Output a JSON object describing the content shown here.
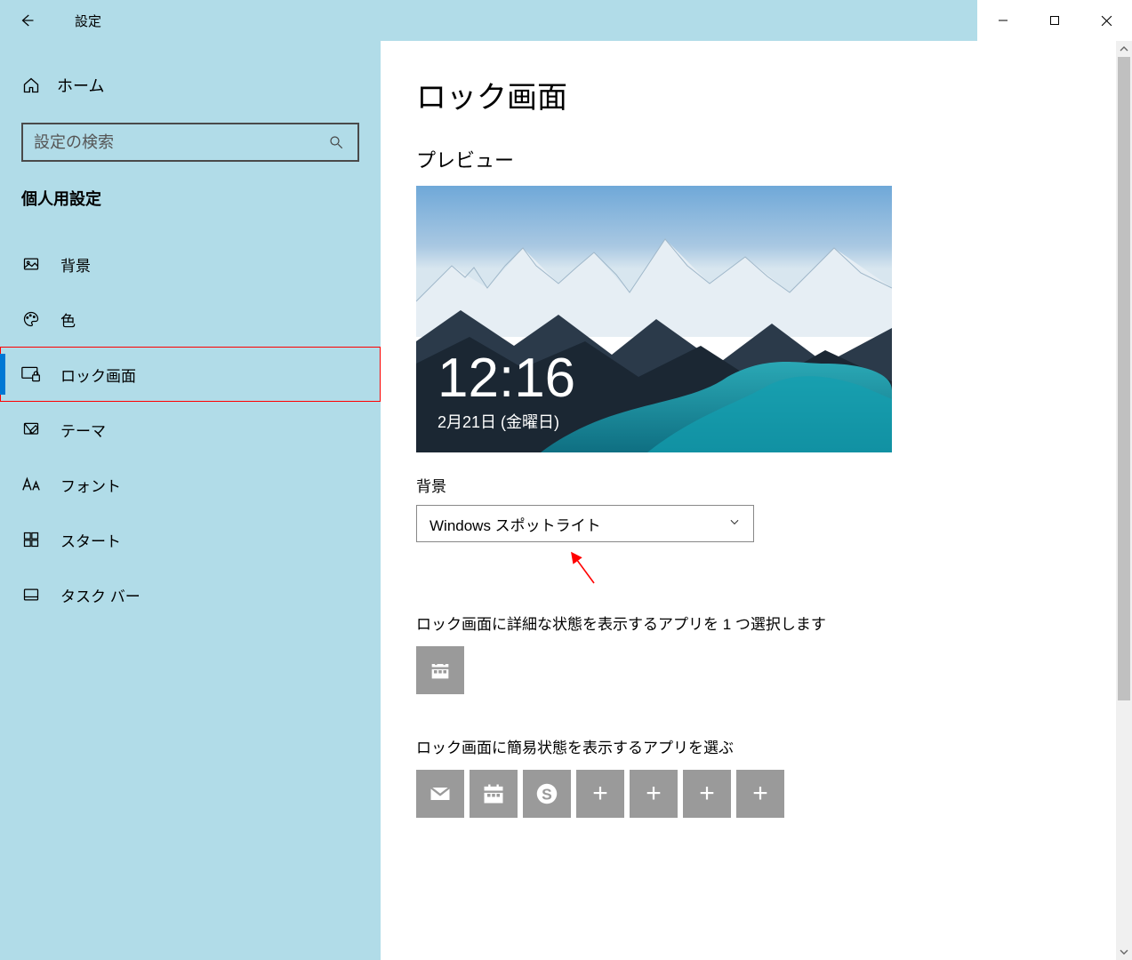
{
  "window": {
    "title": "設定"
  },
  "sidebar": {
    "home": "ホーム",
    "search_placeholder": "設定の検索",
    "section": "個人用設定",
    "items": [
      {
        "label": "背景",
        "icon": "picture-icon",
        "active": false
      },
      {
        "label": "色",
        "icon": "palette-icon",
        "active": false
      },
      {
        "label": "ロック画面",
        "icon": "lock-screen-icon",
        "active": true
      },
      {
        "label": "テーマ",
        "icon": "theme-icon",
        "active": false
      },
      {
        "label": "フォント",
        "icon": "font-icon",
        "active": false
      },
      {
        "label": "スタート",
        "icon": "start-icon",
        "active": false
      },
      {
        "label": "タスク バー",
        "icon": "taskbar-icon",
        "active": false
      }
    ]
  },
  "main": {
    "heading": "ロック画面",
    "preview_label": "プレビュー",
    "preview_time": "12:16",
    "preview_date": "2月21日 (金曜日)",
    "background_label": "背景",
    "background_value": "Windows スポットライト",
    "detailed_app_label": "ロック画面に詳細な状態を表示するアプリを 1 つ選択します",
    "quick_apps_label": "ロック画面に簡易状態を表示するアプリを選ぶ",
    "quick_apps": [
      {
        "icon": "mail-icon"
      },
      {
        "icon": "calendar-icon"
      },
      {
        "icon": "skype-icon"
      },
      {
        "icon": "plus-icon"
      },
      {
        "icon": "plus-icon"
      },
      {
        "icon": "plus-icon"
      },
      {
        "icon": "plus-icon"
      }
    ]
  }
}
